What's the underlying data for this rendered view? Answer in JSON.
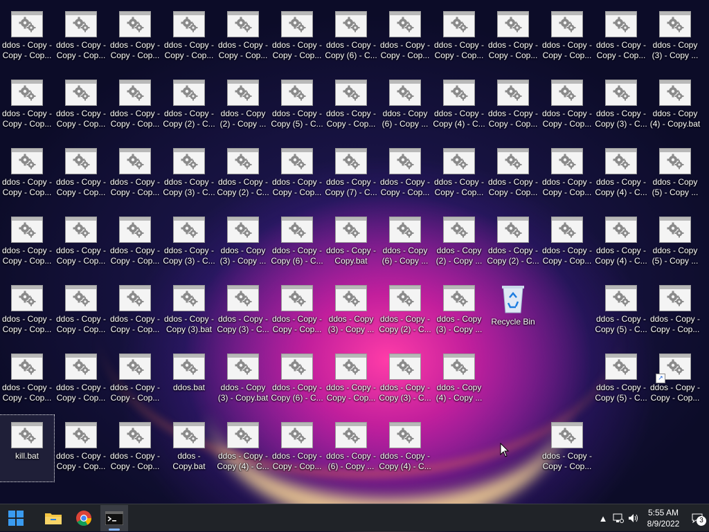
{
  "desktop": {
    "rows": [
      [
        "ddos - Copy -\nCopy - Cop...",
        "ddos - Copy -\nCopy - Cop...",
        "ddos - Copy -\nCopy - Cop...",
        "ddos - Copy -\nCopy - Cop...",
        "ddos - Copy -\nCopy - Cop...",
        "ddos - Copy -\nCopy - Cop...",
        "ddos - Copy -\nCopy (6) - C...",
        "ddos - Copy -\nCopy - Cop...",
        "ddos - Copy -\nCopy - Cop...",
        "ddos - Copy -\nCopy - Cop...",
        "ddos - Copy -\nCopy - Cop...",
        "ddos - Copy -\nCopy - Cop...",
        "ddos - Copy\n(3) - Copy ..."
      ],
      [
        "ddos - Copy -\nCopy - Cop...",
        "ddos - Copy -\nCopy - Cop...",
        "ddos - Copy -\nCopy - Cop...",
        "ddos - Copy -\nCopy (2) - C...",
        "ddos - Copy\n(2) - Copy ...",
        "ddos - Copy -\nCopy (5) - C...",
        "ddos - Copy -\nCopy - Cop...",
        "ddos - Copy\n(6) - Copy ...",
        "ddos - Copy -\nCopy (4) - C...",
        "ddos - Copy -\nCopy - Cop...",
        "ddos - Copy -\nCopy - Cop...",
        "ddos - Copy -\nCopy (3) - C...",
        "ddos - Copy\n(4) - Copy.bat"
      ],
      [
        "ddos - Copy -\nCopy - Cop...",
        "ddos - Copy -\nCopy - Cop...",
        "ddos - Copy -\nCopy - Cop...",
        "ddos - Copy -\nCopy (3) - C...",
        "ddos - Copy -\nCopy (2) - C...",
        "ddos - Copy -\nCopy - Cop...",
        "ddos - Copy -\nCopy (7) - C...",
        "ddos - Copy -\nCopy - Cop...",
        "ddos - Copy -\nCopy - Cop...",
        "ddos - Copy -\nCopy - Cop...",
        "ddos - Copy -\nCopy - Cop...",
        "ddos - Copy -\nCopy (4) - C...",
        "ddos - Copy\n(5) - Copy ..."
      ],
      [
        "ddos - Copy -\nCopy - Cop...",
        "ddos - Copy -\nCopy - Cop...",
        "ddos - Copy -\nCopy - Cop...",
        "ddos - Copy -\nCopy (3) - C...",
        "ddos - Copy\n(3) - Copy ...",
        "ddos - Copy -\nCopy (6) - C...",
        "ddos - Copy -\nCopy.bat",
        "ddos - Copy\n(6) - Copy ...",
        "ddos - Copy\n(2) - Copy ...",
        "ddos - Copy -\nCopy (2) - C...",
        "ddos - Copy -\nCopy - Cop...",
        "ddos - Copy -\nCopy (4) - C...",
        "ddos - Copy\n(5) - Copy ..."
      ],
      [
        "ddos - Copy -\nCopy - Cop...",
        "ddos - Copy -\nCopy - Cop...",
        "ddos - Copy -\nCopy - Cop...",
        "ddos - Copy -\nCopy (3).bat",
        "ddos - Copy -\nCopy (3) - C...",
        "ddos - Copy -\nCopy - Cop...",
        "ddos - Copy\n(3) - Copy ...",
        "ddos - Copy -\nCopy (2) - C...",
        "ddos - Copy\n(3) - Copy ...",
        null,
        null,
        "ddos - Copy -\nCopy (5) - C...",
        "ddos - Copy -\nCopy - Cop..."
      ],
      [
        "ddos - Copy -\nCopy - Cop...",
        "ddos - Copy -\nCopy - Cop...",
        "ddos - Copy -\nCopy - Cop...",
        "ddos.bat",
        "ddos - Copy\n(3) - Copy.bat",
        "ddos - Copy -\nCopy (6) - C...",
        "ddos - Copy -\nCopy - Cop...",
        "ddos - Copy -\nCopy (3) - C...",
        "ddos - Copy\n(4) - Copy ...",
        null,
        null,
        "ddos - Copy -\nCopy (5) - C...",
        "ddos - Copy -\nCopy - Cop..."
      ],
      [
        "kill.bat",
        "ddos - Copy -\nCopy - Cop...",
        "ddos - Copy -\nCopy - Cop...",
        "ddos -\nCopy.bat",
        "ddos - Copy -\nCopy (4) - C...",
        "ddos - Copy -\nCopy - Cop...",
        "ddos - Copy -\n(6) - Copy ...",
        "ddos - Copy -\nCopy (4) - C...",
        null,
        null,
        "ddos - Copy -\nCopy - Cop...",
        null,
        null
      ]
    ],
    "recycle_bin_label": "Recycle Bin"
  },
  "taskbar": {
    "apps": [
      {
        "name": "start",
        "icon": "windows-logo-icon"
      },
      {
        "name": "file-explorer",
        "icon": "folder-icon"
      },
      {
        "name": "chrome",
        "icon": "chrome-icon"
      },
      {
        "name": "command-prompt",
        "icon": "terminal-icon",
        "active": true
      }
    ],
    "time": "5:55 AM",
    "date": "8/9/2022",
    "notification_count": "3"
  }
}
